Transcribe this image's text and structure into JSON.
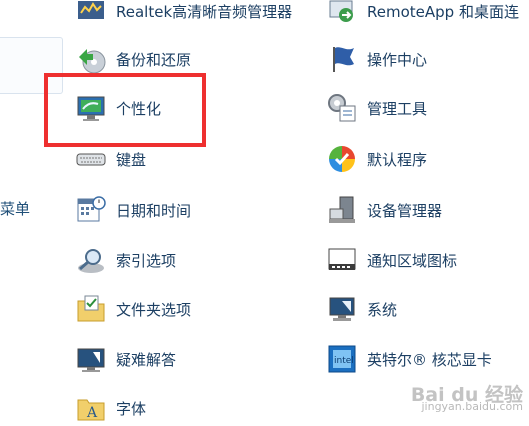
{
  "sidebar": {
    "partial_label": "菜单"
  },
  "left_column": [
    {
      "label": "Realtek高清晰音频管理器",
      "icon": "audio-manager-icon"
    },
    {
      "label": "备份和还原",
      "icon": "backup-restore-icon"
    },
    {
      "label": "个性化",
      "icon": "personalization-icon"
    },
    {
      "label": "键盘",
      "icon": "keyboard-icon"
    },
    {
      "label": "日期和时间",
      "icon": "calendar-clock-icon"
    },
    {
      "label": "索引选项",
      "icon": "search-index-icon"
    },
    {
      "label": "文件夹选项",
      "icon": "folder-options-icon"
    },
    {
      "label": "疑难解答",
      "icon": "troubleshooting-icon"
    },
    {
      "label": "字体",
      "icon": "fonts-folder-icon"
    }
  ],
  "right_column": [
    {
      "label": "RemoteApp 和桌面连",
      "icon": "remoteapp-icon"
    },
    {
      "label": "操作中心",
      "icon": "action-center-flag-icon"
    },
    {
      "label": "管理工具",
      "icon": "admin-tools-icon"
    },
    {
      "label": "默认程序",
      "icon": "default-programs-icon"
    },
    {
      "label": "设备管理器",
      "icon": "device-manager-icon"
    },
    {
      "label": "通知区域图标",
      "icon": "notification-area-icon"
    },
    {
      "label": "系统",
      "icon": "system-icon"
    },
    {
      "label": "英特尔® 核芯显卡",
      "icon": "intel-graphics-icon"
    }
  ],
  "highlight_color": "#ee2f2f",
  "watermark": {
    "line1": "Bai du 经验",
    "line2": "jingyan.baidu.com"
  }
}
